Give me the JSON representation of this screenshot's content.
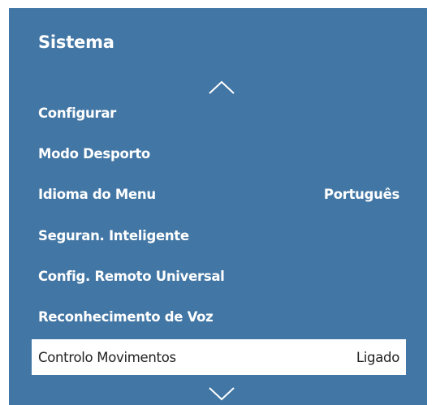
{
  "header": {
    "title": "Sistema"
  },
  "icons": {
    "up": "chevron-up-icon",
    "down": "chevron-down-icon"
  },
  "menu": {
    "items": [
      {
        "label": "Configurar",
        "value": ""
      },
      {
        "label": "Modo Desporto",
        "value": ""
      },
      {
        "label": "Idioma do Menu",
        "value": "Português"
      },
      {
        "label": "Seguran. Inteligente",
        "value": ""
      },
      {
        "label": "Config. Remoto Universal",
        "value": ""
      },
      {
        "label": "Reconhecimento de Voz",
        "value": ""
      },
      {
        "label": "Controlo Movimentos",
        "value": "Ligado",
        "selected": true
      }
    ]
  },
  "colors": {
    "panel_background": "#4276a4",
    "selected_background": "#ffffff",
    "text": "#ffffff",
    "selected_text": "#222222"
  }
}
